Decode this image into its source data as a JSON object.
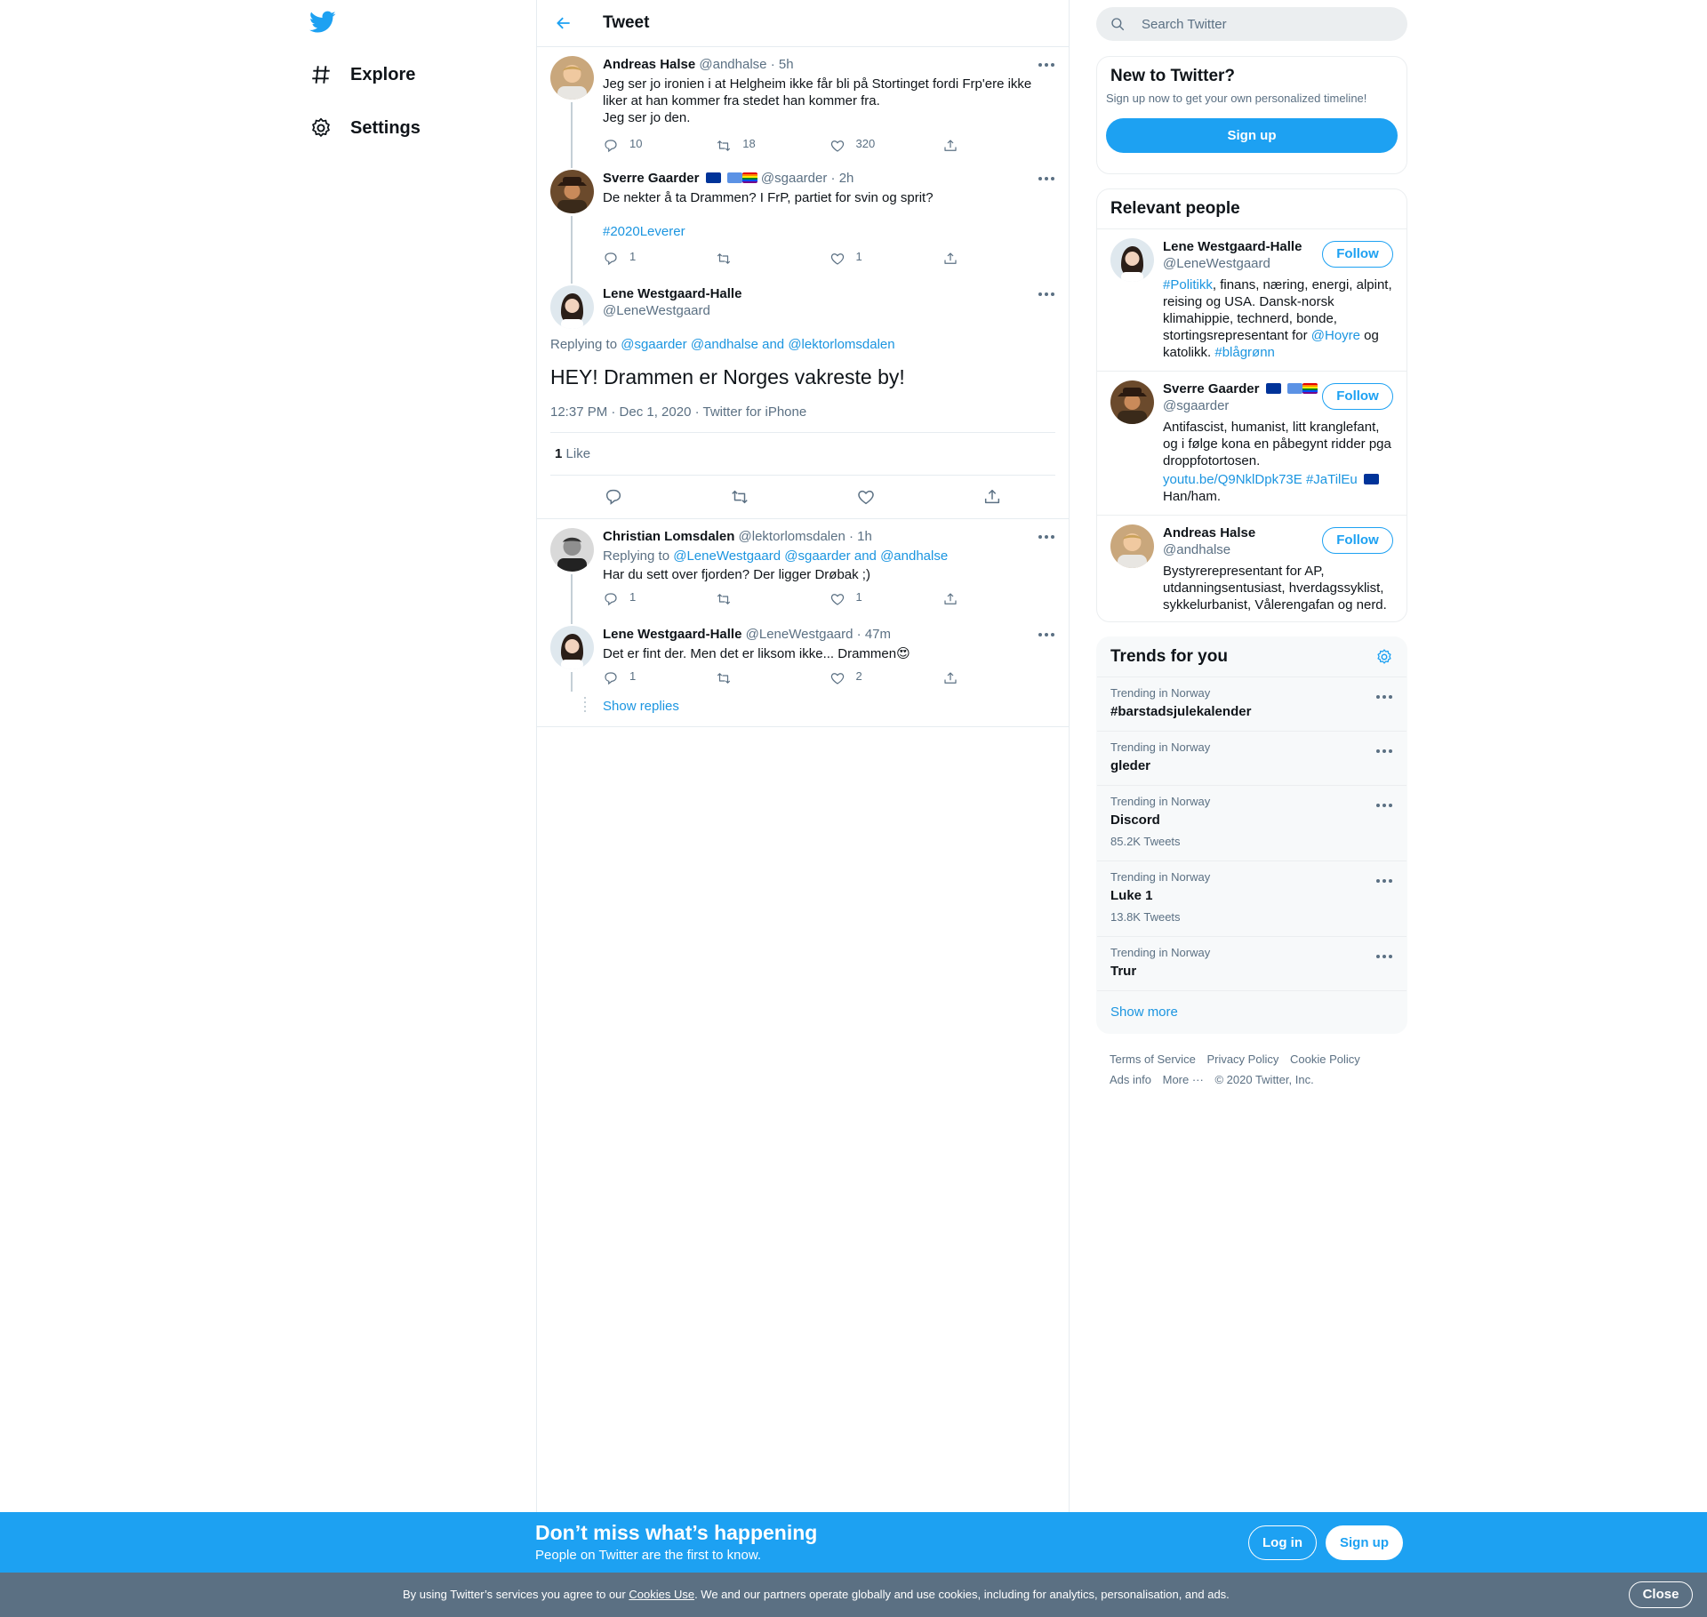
{
  "nav": {
    "items": [
      {
        "label": "Explore",
        "icon": "hashtag-icon"
      },
      {
        "label": "Settings",
        "icon": "gear-icon"
      }
    ]
  },
  "header": {
    "title": "Tweet"
  },
  "thread": [
    {
      "name": "Andreas Halse",
      "handle": "@andhalse",
      "time": "· 5h",
      "text_lines": [
        "Jeg ser jo ironien i at Helgheim ikke får bli på Stortinget fordi Frp'ere ikke",
        "liker at han kommer fra stedet han kommer fra.",
        "Jeg ser jo den."
      ],
      "replies": "10",
      "retweets": "18",
      "likes": "320"
    },
    {
      "name": "Sverre Gaarder",
      "handle": "@sgaarder",
      "time": "· 2h",
      "text": "De nekter å ta Drammen? I FrP, partiet for svin og sprit?",
      "hashtag": "#2020Leverer",
      "replies": "1",
      "retweets": "",
      "likes": "1"
    }
  ],
  "focus": {
    "name": "Lene Westgaard-Halle",
    "handle": "@LeneWestgaard",
    "replying_prefix": "Replying to",
    "replying_1": "@sgaarder",
    "replying_2": "@andhalse",
    "replying_and": "and",
    "replying_3": "@lektorlomsdalen",
    "text": "HEY! Drammen er Norges vakreste by!",
    "meta": "12:37 PM · Dec 1, 2020 · Twitter for iPhone",
    "like_count": "1",
    "like_label": "Like"
  },
  "replies": [
    {
      "name": "Christian Lomsdalen",
      "handle": "@lektorlomsdalen",
      "time": "· 1h",
      "replying_prefix": "Replying to",
      "replying_1": "@LeneWestgaard",
      "replying_2": "@sgaarder",
      "replying_and": "and",
      "replying_3": "@andhalse",
      "text": "Har du sett over fjorden? Der ligger Drøbak ;)",
      "replies": "1",
      "retweets": "",
      "likes": "1"
    },
    {
      "name": "Lene Westgaard-Halle",
      "handle": "@LeneWestgaard",
      "time": "· 47m",
      "text": "Det er fint der. Men det er liksom ikke... Drammen😍",
      "replies": "1",
      "retweets": "",
      "likes": "2"
    }
  ],
  "show_replies": "Show replies",
  "search": {
    "placeholder": "Search Twitter"
  },
  "new_to_twitter": {
    "title": "New to Twitter?",
    "subtitle": "Sign up now to get your own personalized timeline!",
    "button": "Sign up"
  },
  "relevant_people": {
    "title": "Relevant people",
    "follow_label": "Follow",
    "people": [
      {
        "name": "Lene Westgaard-Halle",
        "handle": "@LeneWestgaard",
        "bio_tag1": "#Politikk",
        "bio_text1": ", finans, næring, energi, alpint, reising og USA. Dansk-norsk klimahippie, technerd, bonde, stortingsrepresentant for ",
        "bio_mention": "@Hoyre",
        "bio_text2": " og katolikk. ",
        "bio_tag2": "#blågrønn"
      },
      {
        "name": "Sverre Gaarder",
        "handle": "@sgaarder",
        "bio_text1": "Antifascist, humanist, litt kranglefant, og i følge kona en påbegynt ridder pga droppfotortosen.",
        "bio_link": "youtu.be/Q9NklDpk73E",
        "bio_tag": "#JaTilEu",
        "bio_text2": "Han/ham."
      },
      {
        "name": "Andreas Halse",
        "handle": "@andhalse",
        "bio": "Bystyrerepresentant for AP, utdanningsentusiast, hverdagssyklist, sykkelurbanist, Vålerengafan og nerd."
      }
    ]
  },
  "trends": {
    "title": "Trends for you",
    "items": [
      {
        "category": "Trending in Norway",
        "name": "#barstadsjulekalender",
        "count": ""
      },
      {
        "category": "Trending in Norway",
        "name": "gleder",
        "count": ""
      },
      {
        "category": "Trending in Norway",
        "name": "Discord",
        "count": "85.2K Tweets"
      },
      {
        "category": "Trending in Norway",
        "name": "Luke 1",
        "count": "13.8K Tweets"
      },
      {
        "category": "Trending in Norway",
        "name": "Trur",
        "count": ""
      }
    ],
    "show_more": "Show more"
  },
  "footer": {
    "terms": "Terms of Service",
    "privacy": "Privacy Policy",
    "cookie": "Cookie Policy",
    "ads": "Ads info",
    "more": "More ···",
    "copyright": "© 2020 Twitter, Inc."
  },
  "banner": {
    "title": "Don’t miss what’s happening",
    "subtitle": "People on Twitter are the first to know.",
    "login": "Log in",
    "signup": "Sign up"
  },
  "cookie_bar": {
    "text_before": "By using Twitter’s services you agree to our ",
    "link": "Cookies Use",
    "text_after": ". We and our partners operate globally and use cookies, including for analytics, personalisation, and ads.",
    "close": "Close"
  },
  "colors": {
    "accent": "#1da1f2",
    "link": "#1b95e0",
    "muted": "#5b7083"
  }
}
